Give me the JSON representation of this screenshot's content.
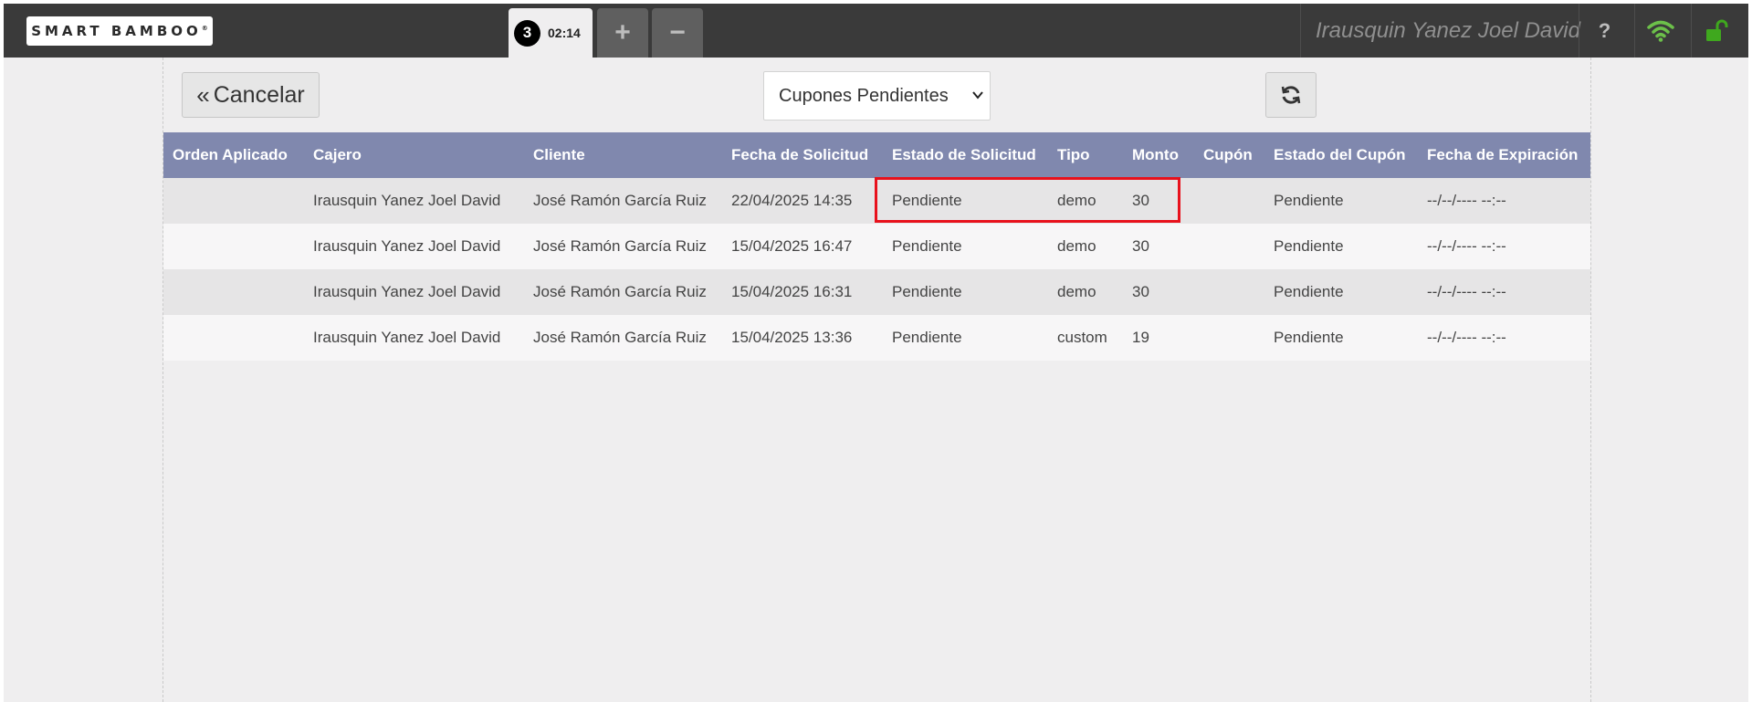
{
  "logo": {
    "text": "SMART BAMBOO",
    "mark": "®"
  },
  "tabs": {
    "badge": "3",
    "timer": "02:14",
    "add_label": "+",
    "remove_label": "−"
  },
  "user": {
    "name": "Irausquin Yanez Joel David"
  },
  "icons": {
    "help": "?",
    "wifi": "wifi-icon",
    "lock": "unlock-icon",
    "wifi_color": "#6cc04a",
    "lock_color": "#3fa81e"
  },
  "toolbar": {
    "cancel_label": "Cancelar",
    "filter_selected": "Cupones Pendientes",
    "refresh": "refresh-icon"
  },
  "table": {
    "headers": [
      "Orden Aplicado",
      "Cajero",
      "Cliente",
      "Fecha de Solicitud",
      "Estado de Solicitud",
      "Tipo",
      "Monto",
      "Cupón",
      "Estado del Cupón",
      "Fecha de Expiración"
    ],
    "rows": [
      [
        "",
        "Irausquin Yanez Joel David",
        "José Ramón García Ruiz",
        "22/04/2025 14:35",
        "Pendiente",
        "demo",
        "30",
        "",
        "Pendiente",
        "--/--/---- --:--"
      ],
      [
        "",
        "Irausquin Yanez Joel David",
        "José Ramón García Ruiz",
        "15/04/2025 16:47",
        "Pendiente",
        "demo",
        "30",
        "",
        "Pendiente",
        "--/--/---- --:--"
      ],
      [
        "",
        "Irausquin Yanez Joel David",
        "José Ramón García Ruiz",
        "15/04/2025 16:31",
        "Pendiente",
        "demo",
        "30",
        "",
        "Pendiente",
        "--/--/---- --:--"
      ],
      [
        "",
        "Irausquin Yanez Joel David",
        "José Ramón García Ruiz",
        "15/04/2025 13:36",
        "Pendiente",
        "custom",
        "19",
        "",
        "Pendiente",
        "--/--/---- --:--"
      ]
    ]
  },
  "colors": {
    "header_bg": "#8088ae",
    "topbar_bg": "#3a3a3a",
    "highlight": "#e8111c"
  }
}
